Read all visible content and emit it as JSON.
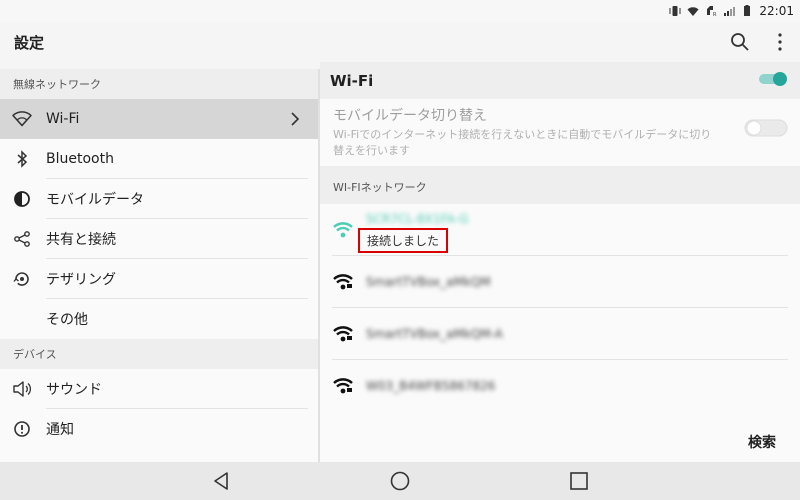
{
  "status_bar": {
    "time": "22:01",
    "icons": [
      "vibrate-icon",
      "wifi-icon",
      "network-icon",
      "signal-icon",
      "battery-icon"
    ]
  },
  "appbar": {
    "title": "設定",
    "icons": [
      "search-icon",
      "more-vert-icon"
    ]
  },
  "sidebar": {
    "section1": "無線ネットワーク",
    "items": [
      {
        "label": "Wi-Fi",
        "icon": "wifi-icon"
      },
      {
        "label": "Bluetooth",
        "icon": "bluetooth-icon"
      },
      {
        "label": "モバイルデータ",
        "icon": "mobile-data-icon"
      },
      {
        "label": "共有と接続",
        "icon": "share-icon"
      },
      {
        "label": "テザリング",
        "icon": "tethering-icon"
      },
      {
        "label": "その他",
        "icon": ""
      }
    ],
    "section2": "デバイス",
    "items2": [
      {
        "label": "サウンド",
        "icon": "sound-icon"
      },
      {
        "label": "通知",
        "icon": "notification-icon"
      }
    ]
  },
  "main": {
    "wifi_title": "Wi-Fi",
    "wifi_enabled": true,
    "mobile_switch": {
      "title": "モバイルデータ切り替え",
      "description": "Wi-Fiでのインターネット接続を行えないときに自動でモバイルデータに切り替えを行います"
    },
    "network_header": "WI-FIネットワーク",
    "networks": [
      {
        "name": "SCR7CL-8X1FA-G",
        "status": "接続しました",
        "connected": true
      },
      {
        "name": "SmartTVBox_aMkQM",
        "status": "",
        "connected": false
      },
      {
        "name": "SmartTVBox_aMkQM-A",
        "status": "",
        "connected": false
      },
      {
        "name": "W03_B4WFB5867826",
        "status": "",
        "connected": false
      }
    ],
    "scan_label": "検索"
  },
  "colors": {
    "accent": "#26a69a",
    "connected": "#4ecdb4",
    "highlight": "#d90000"
  }
}
